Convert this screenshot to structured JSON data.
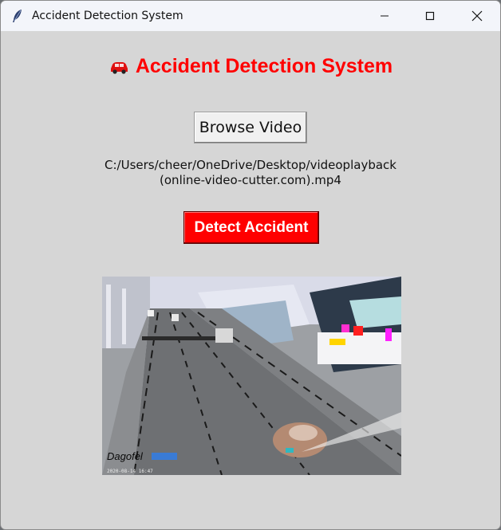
{
  "window": {
    "title": "Accident Detection System",
    "controls": [
      "minimize-icon",
      "maximize-icon",
      "close-icon"
    ]
  },
  "header": {
    "icon": "car-icon",
    "title": "Accident Detection System",
    "color": "#ff0000"
  },
  "browse": {
    "label": "Browse Video"
  },
  "file": {
    "path_line1": "C:/Users/cheer/OneDrive/Desktop/videoplayback",
    "path_line2": "(online-video-cutter.com).mp4"
  },
  "detect": {
    "label": "Detect Accident",
    "color": "#ff0000"
  },
  "video": {
    "watermark": "Dagofel",
    "timestamp": "2020-08-14 16:47"
  }
}
